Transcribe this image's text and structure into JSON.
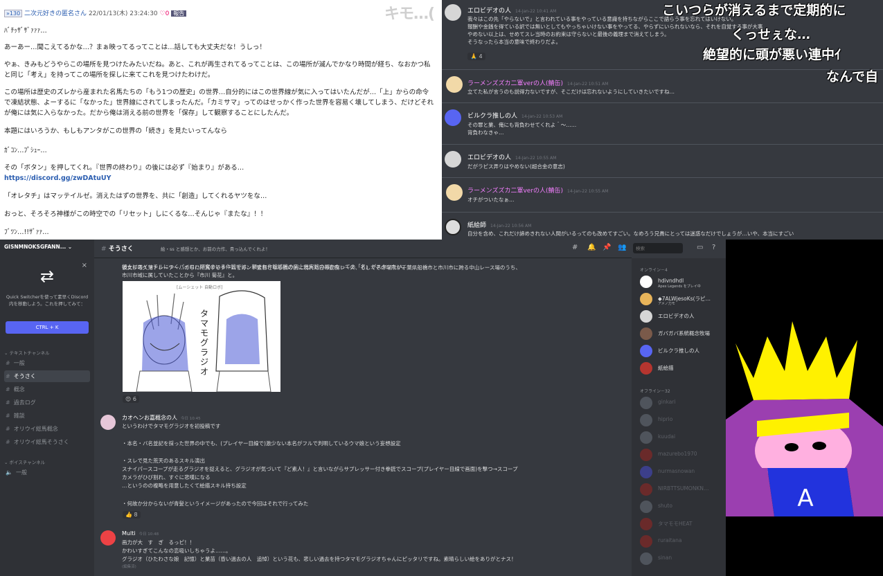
{
  "forum": {
    "res_no": "»130",
    "author": "二次元好きの匿名さん",
    "date": "22/01/13(木) 23:24:30",
    "likes": "♡0",
    "report": "報告",
    "nico_overlay": "キモ…(",
    "lines": [
      "ﾊﾞﾁｯｻﾞｻﾞｧｧｧ…",
      "あーあー…聞こえてるかな…？まぁ映ってるってことは…話しても大丈夫だな！うしっ！",
      "やぁ、きみもどうやらこの場所を見つけたみたいだね。あと、これが再生されてるってことは、この場所が滅んでかなり時間が経ち、なおかつ私と同じ「考え」を持ってこの場所を探しに来てこれを見つけたわけだ。",
      "この場所は歴史のズレから産まれた名馬たちの「もう1つの歴史」の世界…自分的にはこの世界線が気に入ってはいたんだが…「上」からの命令で凍結状態、よーするに「なかった」世界線にされてしまったんだ。「カミサマ」ってのはせっかく作った世界を容易く壊してしまう、だけどそれが俺には気に入らなかった。だから俺は消える前の世界を「保存」して観察することにしたんだ。",
      "本題にはいろうか、もしもアンタがこの世界の「続き」を見たいってんなら",
      "ｶﾞｺﾝ…ﾌﾟｼｭｰ…",
      "その「ボタン」を押してくれ。『世界の終わり』の後には必ず『始まり』がある…",
      "https://discord.gg/zwDAtuUY",
      "「オレタチ」はマッテイルゼ。消えたはずの世界を、共に「創造」してくれるヤツをな…",
      "おっと、そろそろ神様がこの時空での「リセット」しにくるな…そんじゃ『またな』！！",
      "ﾌﾞﾂﾝ…!!ｻﾞｧｧ…"
    ]
  },
  "chat": {
    "overlays": [
      "こいつらが消えるまで定期的に",
      "くっせぇな…",
      "絶望的に頭が悪い連中ｲ",
      "なんで自"
    ],
    "messages": [
      {
        "user": "エロビデオの人",
        "time": "14-Jan-22 10:41 AM",
        "lines": [
          "我々はこの先「やらないで」と言われている事をやっている意識を持ちながらここで語らう事を忘れてはいけない。",
          "報酬や金銭を得ている訳では無いとしてもやっちゃいけない事をやってる、やらずにいられないなら、それを自覚する事が大事",
          "やめない以上は、せめてスレ当時のお約束は守らないと最後の義理まで消えてしまう。",
          "そうなったら本当の意味で終わりだよ。"
        ],
        "reaction": "🙏 4"
      },
      {
        "user": "ラーメンズズカ二軍verの人(鯖缶)",
        "time": "14-Jan-22 10:51 AM",
        "lines": [
          "立てた私が言うのも説得力ないですが、そこだけは忘れないようにしていきたいですね…"
        ]
      },
      {
        "user": "ビルクラ推しの人",
        "time": "14-Jan-22 10:53 AM",
        "lines": [
          "その罪と業、俺にも背負わせてくれよ＾～……",
          "背負わなきゃ…"
        ]
      },
      {
        "user": "エロビデオの人",
        "time": "14-Jan-22 10:55 AM",
        "lines": [
          "だがラピス弄りはやめない(超合金の意志)"
        ]
      },
      {
        "user": "ラーメンズズカ二軍verの人(鯖缶)",
        "time": "14-Jan-22 10:55 AM",
        "lines": [
          "オチがついたなぁ…"
        ]
      },
      {
        "user": "紙絵師",
        "time": "14-Jan-22 10:56 AM",
        "lines": [
          "自分を含め、これだけ諦めきれない人間がいるってのも改めてすごい。なめろう兄貴にとっては迷惑なだけでしょうが…いや、本当にすごい"
        ]
      }
    ]
  },
  "discord": {
    "server": "GISNMNOKSGFANN...",
    "quick_switcher": "Quick Switcherを使って素早くDiscord内を移動しよう。これを押してみて：",
    "shortcut": "CTRL + K",
    "text_category": "テキストチャンネル",
    "voice_category": "ボイスチャンネル",
    "channels": [
      "一般",
      "そうさく",
      "概念",
      "過去ログ",
      "雑談",
      "オリウイ総馬概念",
      "オリウイ総馬そうさく"
    ],
    "voice_channels": [
      "一般"
    ],
    "channel_title": "そうさく",
    "channel_topic": "絵・ss と感想とか、お前の力作、貴っ込んでくれよ！",
    "search_placeholder": "検索",
    "msg_top_lines": [
      "領土にスイッチルにつくパイロハ研究のいる作戦では、頼まれ作戦結戦の実上元実戦の場かなっての「名」がスタツたい。",
      "彼女が噂久薄トレーナー…のちに所属するチームセガンド監督となる彼の前に現れた日の勤務レース、そしてその場所が千葉県船橋市と市川市に跨る中山レース場のうち、",
      "市川市域に属していたことから『市川 菊花』と。"
    ],
    "sketch_caption": "[ムーシェット 自動ロボ]",
    "sketch_names": "タマモ グラジオ",
    "reaction1": "😍 6",
    "post2": {
      "user": "カオヘンお嘉概念の人",
      "time": "今日 10:45",
      "lines": [
        "というわけでタマモグラジオを初投稿です",
        "",
        "・本名・バ名並記を採った世界の中でも、(プレイヤー目線で)激少ない本名がフルで判明しているウマ娘という妄想設定",
        "",
        "・スレで見た荒天のあるスキル演出",
        "スナイパースコープが走るグラジオを捉えると、グラジオが気づいて『ど素人！』と言いながらサプレッサー付き拳銃でスコープ(プレイヤー目線で画面)を撃つ→スコープ",
        "カメラがひび割れ、すぐに悲嘆になる",
        "…というのの複略を用意したくて絵描スキル持ち設定",
        "",
        "・何故か分からないが青髪というイメージがあったので今回はそれで行ってみた"
      ],
      "reaction": "👍 8"
    },
    "post3": {
      "user": "Multi",
      "time": "今日 10:48",
      "lines": [
        "画力が大　す　ぎ　るっピ！！",
        "かわいすぎてこんなの恋吸いしちゃうよ……。",
        "グラジオ（ひたわさな娘　記憶）と業苗（昏い過去の人　追悼）という花も、悲しい過去を持つタマモグラジオちゃんにピッタリですね。素晴らしい絵をありがとナス！"
      ],
      "edited": "(編集済)"
    },
    "members_online": "オンライン－4",
    "members_offline": "オフライン－32",
    "online": [
      {
        "name": "hdivndhdl",
        "sub": "Apex Legends をプレイ中"
      },
      {
        "name": "◆7ALWjesoKs(ラピ…",
        "sub": "アメノ力モ"
      },
      {
        "name": "エロビデオの人",
        "sub": ""
      },
      {
        "name": "ガバガバ系統概念牧場",
        "sub": ""
      },
      {
        "name": "ビルクラ推しの人",
        "sub": ""
      },
      {
        "name": "紙絵描",
        "sub": ""
      }
    ],
    "offline": [
      "ginkari",
      "hiprio",
      "kuudai",
      "mazurebo1970",
      "nurmasnowan",
      "NIRBTTSUMONKN…",
      "shuto",
      "タマモモHEAT",
      "ruraitana",
      "sinan"
    ]
  },
  "colors": {
    "discord_bg": "#36393f",
    "sidebar_bg": "#2f3136",
    "blurple": "#5865f2",
    "pink_name": "#f47fff",
    "art_yellow": "#fff100",
    "art_purple": "#9b3fb0",
    "art_blue": "#2233dd",
    "art_pink": "#ffb0e0"
  },
  "art": {
    "letter": "A"
  }
}
